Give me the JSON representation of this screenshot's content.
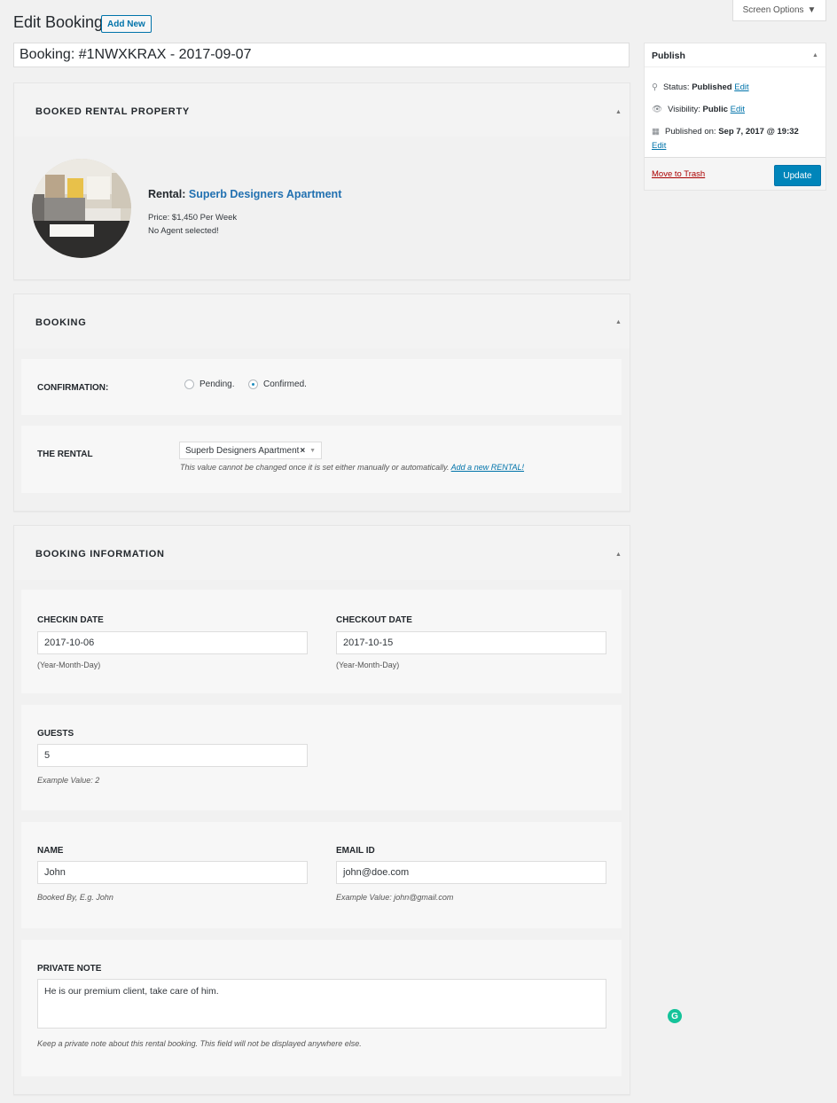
{
  "header": {
    "screen_options": "Screen Options",
    "page_title": "Edit Booking",
    "add_new": "Add New",
    "post_title": "Booking: #1NWXKRAX - 2017-09-07"
  },
  "booked_property": {
    "title": "BOOKED RENTAL PROPERTY",
    "rental_label": "Rental:",
    "rental_name": "Superb Designers Apartment",
    "price": "Price: $1,450 Per Week",
    "agent": "No Agent selected!"
  },
  "booking": {
    "title": "BOOKING",
    "confirmation_label": "CONFIRMATION:",
    "options": [
      "Pending.",
      "Confirmed."
    ],
    "selected": "Confirmed.",
    "rental_label": "THE RENTAL",
    "rental_value": "Superb Designers Apartment",
    "rental_clear": "×",
    "rental_note": "This value cannot be changed once it is set either manually or automatically.",
    "add_rental_link": "Add a new RENTAL!"
  },
  "booking_info": {
    "title": "BOOKING INFORMATION",
    "checkin_label": "CHECKIN DATE",
    "checkin_value": "2017-10-06",
    "checkin_hint": "(Year-Month-Day)",
    "checkout_label": "CHECKOUT DATE",
    "checkout_value": "2017-10-15",
    "checkout_hint": "(Year-Month-Day)",
    "guests_label": "GUESTS",
    "guests_value": "5",
    "guests_hint": "Example Value: 2",
    "name_label": "NAME",
    "name_value": "John",
    "name_hint": "Booked By, E.g. John",
    "email_label": "EMAIL ID",
    "email_value": "john@doe.com",
    "email_hint": "Example Value: john@gmail.com",
    "note_label": "PRIVATE NOTE",
    "note_value": "He is our premium client, take care of him.",
    "note_hint": "Keep a private note about this rental booking. This field will not be displayed anywhere else."
  },
  "publish": {
    "title": "Publish",
    "status_label": "Status:",
    "status_value": "Published",
    "visibility_label": "Visibility:",
    "visibility_value": "Public",
    "published_label": "Published on:",
    "published_value": "Sep 7, 2017 @ 19:32",
    "edit": "Edit",
    "trash": "Move to Trash",
    "update": "Update"
  },
  "colors": {
    "accent": "#0073aa",
    "button": "#0085ba",
    "trash": "#aa0000",
    "background": "#f1f1f1"
  },
  "icons": [
    "dropdown-arrow-icon",
    "collapse-arrow-icon",
    "pin-icon",
    "eye-icon",
    "calendar-icon",
    "grammarly-icon"
  ]
}
